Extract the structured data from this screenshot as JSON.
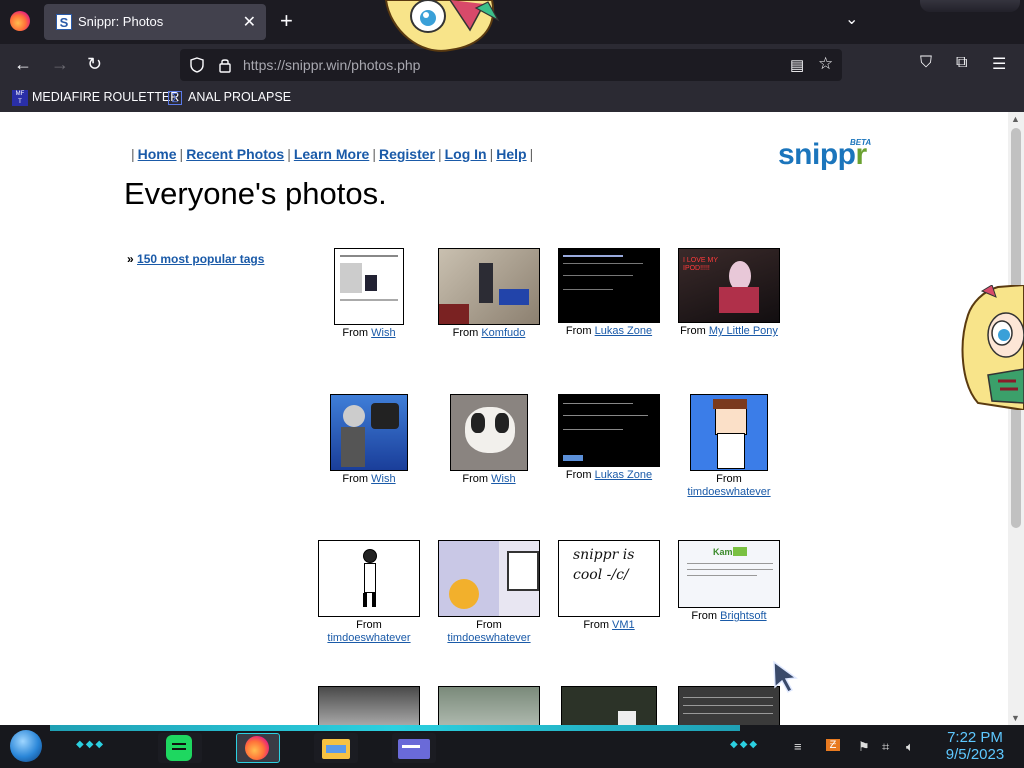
{
  "browser": {
    "tab_title": "Snippr: Photos",
    "tab_favicon": "S",
    "url_host": "https://snippr.win",
    "url_path": "/photos.php",
    "bookmarks": [
      {
        "label": "MEDIAFIRE ROULETTER",
        "icon": "mediafire-icon"
      },
      {
        "label": "ANAL PROLAPSE",
        "icon": "bookmark-icon"
      }
    ]
  },
  "site": {
    "nav_sep": "|",
    "nav": [
      "Home",
      "Recent Photos",
      "Learn More",
      "Register",
      "Log In",
      "Help"
    ],
    "logo_main": "snipp",
    "logo_r": "r",
    "logo_beta": "BETA",
    "heading": "Everyone's photos.",
    "tags_prefix": "»",
    "tags_link": "150 most popular tags"
  },
  "photos": [
    {
      "from": "From",
      "source": "Wish"
    },
    {
      "from": "From",
      "source": "Komfudo"
    },
    {
      "from": "From",
      "source": "Lukas Zone"
    },
    {
      "from": "From",
      "source": "My Little Pony",
      "text": "I LOVE MY IPOD!!!!!"
    },
    {
      "from": "From",
      "source": "Wish"
    },
    {
      "from": "From",
      "source": "Wish"
    },
    {
      "from": "From",
      "source": "Lukas Zone"
    },
    {
      "from": "From",
      "source": "timdoeswhatever"
    },
    {
      "from": "From",
      "source": "timdoeswhatever"
    },
    {
      "from": "From",
      "source": "timdoeswhatever"
    },
    {
      "from": "From",
      "source": "VM1",
      "text": "snippr is cool -/c/"
    },
    {
      "from": "From",
      "source": "Brightsoft",
      "text": "Kam"
    }
  ],
  "taskbar": {
    "time": "7:22 PM",
    "date": "9/5/2023"
  }
}
